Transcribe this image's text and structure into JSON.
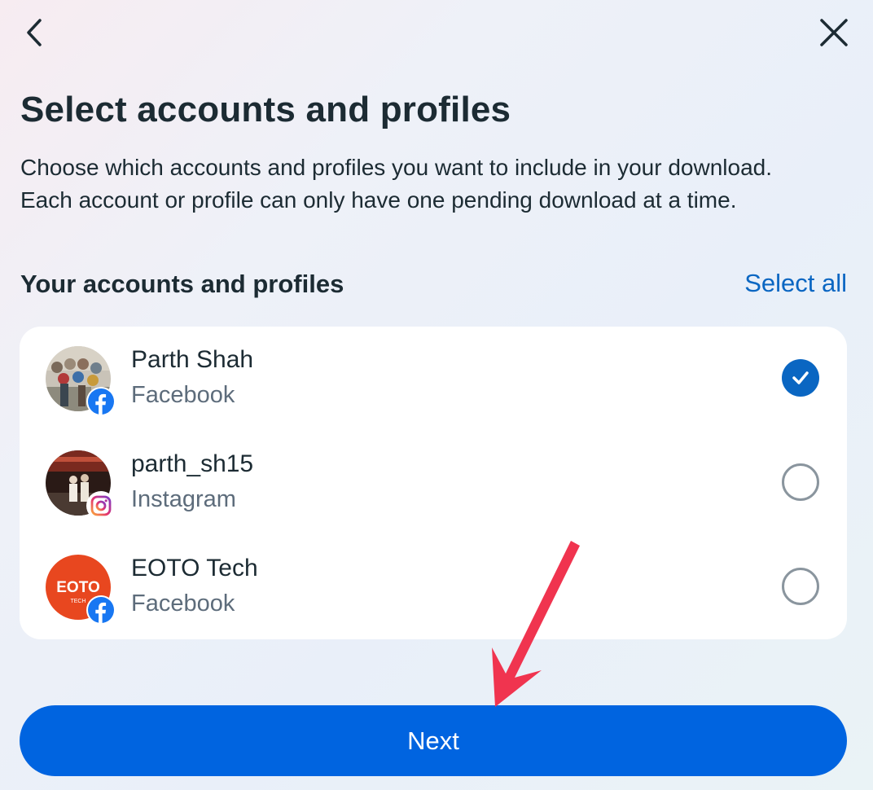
{
  "header": {
    "back_icon": "chevron-left-icon",
    "close_icon": "close-icon"
  },
  "title": "Select accounts and profiles",
  "description": "Choose which accounts and profiles you want to include in your download. Each account or profile can only have one pending download at a time.",
  "section": {
    "title": "Your accounts and profiles",
    "select_all_label": "Select all"
  },
  "accounts": [
    {
      "name": "Parth Shah",
      "platform": "Facebook",
      "selected": true,
      "badge_icon": "facebook-icon"
    },
    {
      "name": "parth_sh15",
      "platform": "Instagram",
      "selected": false,
      "badge_icon": "instagram-icon"
    },
    {
      "name": "EOTO Tech",
      "platform": "Facebook",
      "selected": false,
      "badge_icon": "facebook-icon"
    }
  ],
  "avatar_logo_text": {
    "main": "EOTO",
    "sub": "TECH"
  },
  "next_label": "Next",
  "colors": {
    "accent": "#0064e0",
    "link": "#0a66c2",
    "annotation_arrow": "#f0344f"
  }
}
